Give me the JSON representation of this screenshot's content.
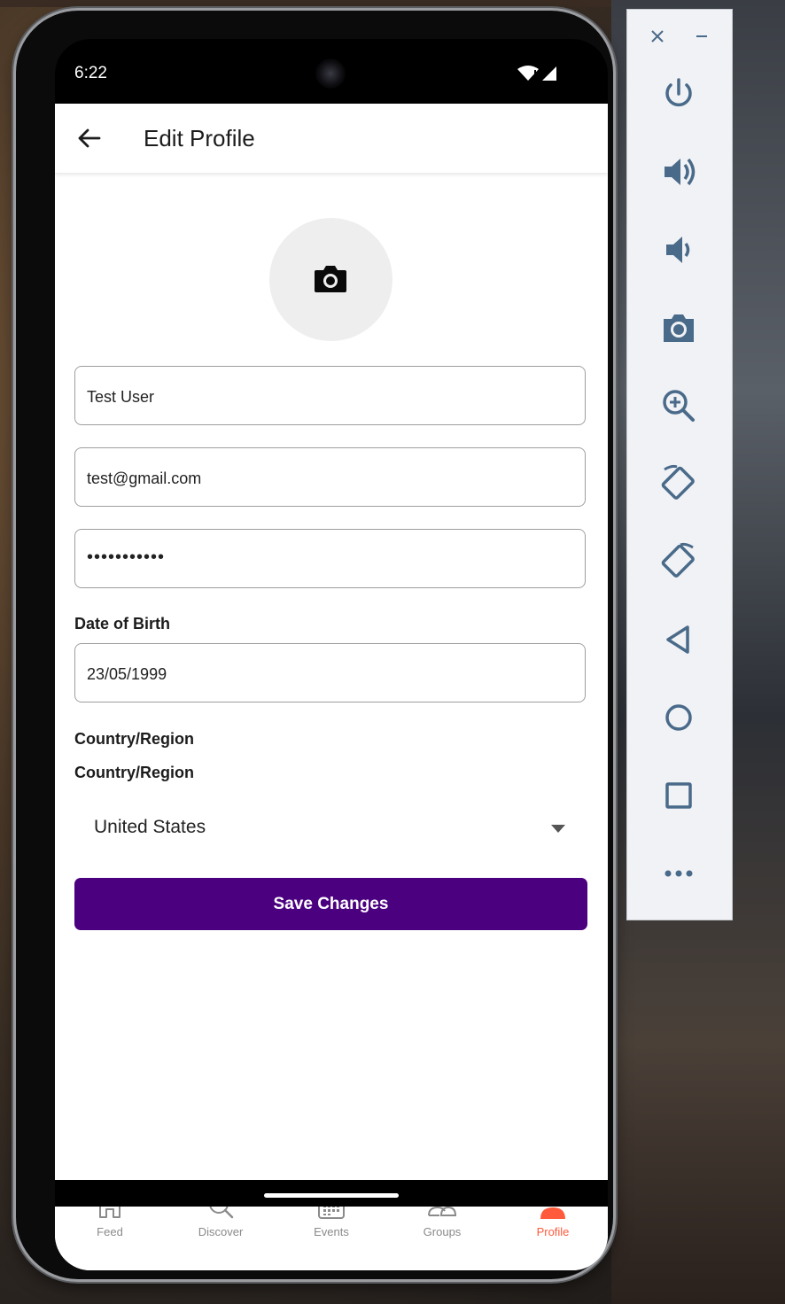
{
  "status_bar": {
    "time": "6:22"
  },
  "app_bar": {
    "title": "Edit Profile"
  },
  "form": {
    "name_value": "Test User",
    "email_value": "test@gmail.com",
    "password_value": "•••••••••••",
    "dob_label": "Date of Birth",
    "dob_value": "23/05/1999",
    "country_label_1": "Country/Region",
    "country_label_2": "Country/Region",
    "country_value": "United States",
    "save_label": "Save Changes"
  },
  "bottom_nav": {
    "items": [
      {
        "label": "Feed",
        "icon": "home-icon"
      },
      {
        "label": "Discover",
        "icon": "search-icon"
      },
      {
        "label": "Events",
        "icon": "calendar-icon"
      },
      {
        "label": "Groups",
        "icon": "groups-icon"
      },
      {
        "label": "Profile",
        "icon": "person-icon",
        "active": true
      }
    ]
  },
  "emulator_toolbar": {
    "items": [
      "close-icon",
      "minimize-icon",
      "power-icon",
      "volume-up-icon",
      "volume-down-icon",
      "screenshot-icon",
      "zoom-icon",
      "rotate-left-icon",
      "rotate-right-icon",
      "back-icon",
      "home-icon",
      "overview-icon",
      "more-icon"
    ]
  },
  "colors": {
    "primary": "#4b0080",
    "active_nav": "#ff5a3c",
    "avatar_bg": "#eeeeee",
    "toolbar_icon": "#4a6a8a"
  }
}
